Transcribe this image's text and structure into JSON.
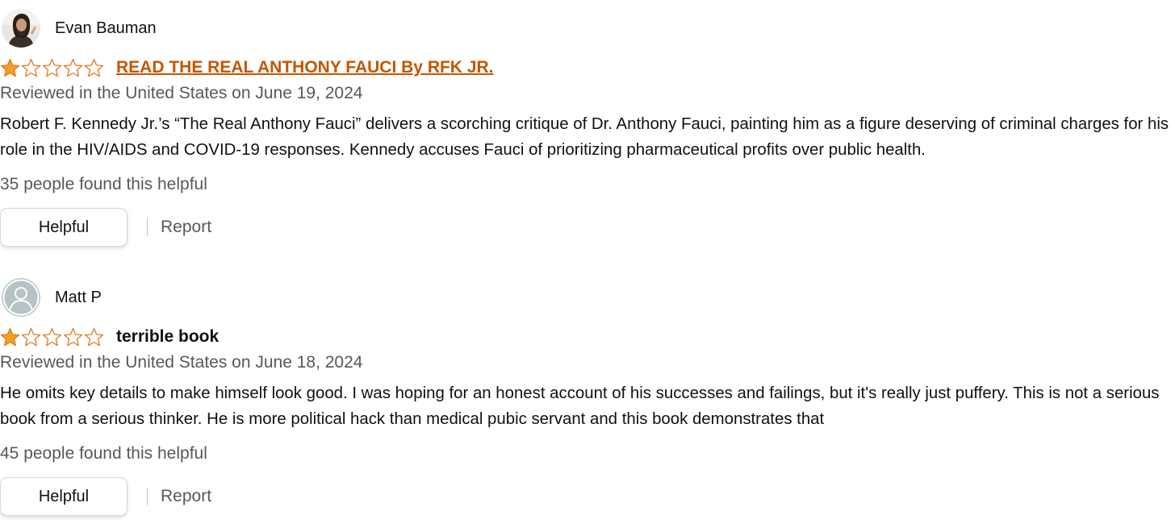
{
  "colors": {
    "star_filled": "#f2a024",
    "star_outline": "#de7921",
    "link": "#c45500",
    "secondary_text": "#565959",
    "primary_text": "#0f1111"
  },
  "reviews": [
    {
      "reviewer_name": "Evan Bauman",
      "avatar": "reviewer-photo",
      "rating": 1,
      "max_rating": 5,
      "title": "READ THE REAL ANTHONY FAUCI By RFK JR.",
      "title_is_link": true,
      "date": "Reviewed in the United States on June 19, 2024",
      "body": "Robert F. Kennedy Jr.’s “The Real Anthony Fauci” delivers a scorching critique of Dr. Anthony Fauci, painting him as a figure deserving of criminal charges for his role in the HIV/AIDS and COVID-19 responses. Kennedy accuses Fauci of prioritizing pharmaceutical profits over public health.",
      "helpful_count_text": "35 people found this helpful",
      "helpful_button": "Helpful",
      "report_link": "Report"
    },
    {
      "reviewer_name": "Matt P",
      "avatar": "default-avatar-icon",
      "rating": 1,
      "max_rating": 5,
      "title": "terrible book",
      "title_is_link": false,
      "date": "Reviewed in the United States on June 18, 2024",
      "body": "He omits key details to make himself look good. I was hoping for an honest account of his successes and failings, but it's really just puffery. This is not a serious book from a serious thinker. He is more political hack than medical pubic servant and this book demonstrates that",
      "helpful_count_text": "45 people found this helpful",
      "helpful_button": "Helpful",
      "report_link": "Report"
    }
  ]
}
